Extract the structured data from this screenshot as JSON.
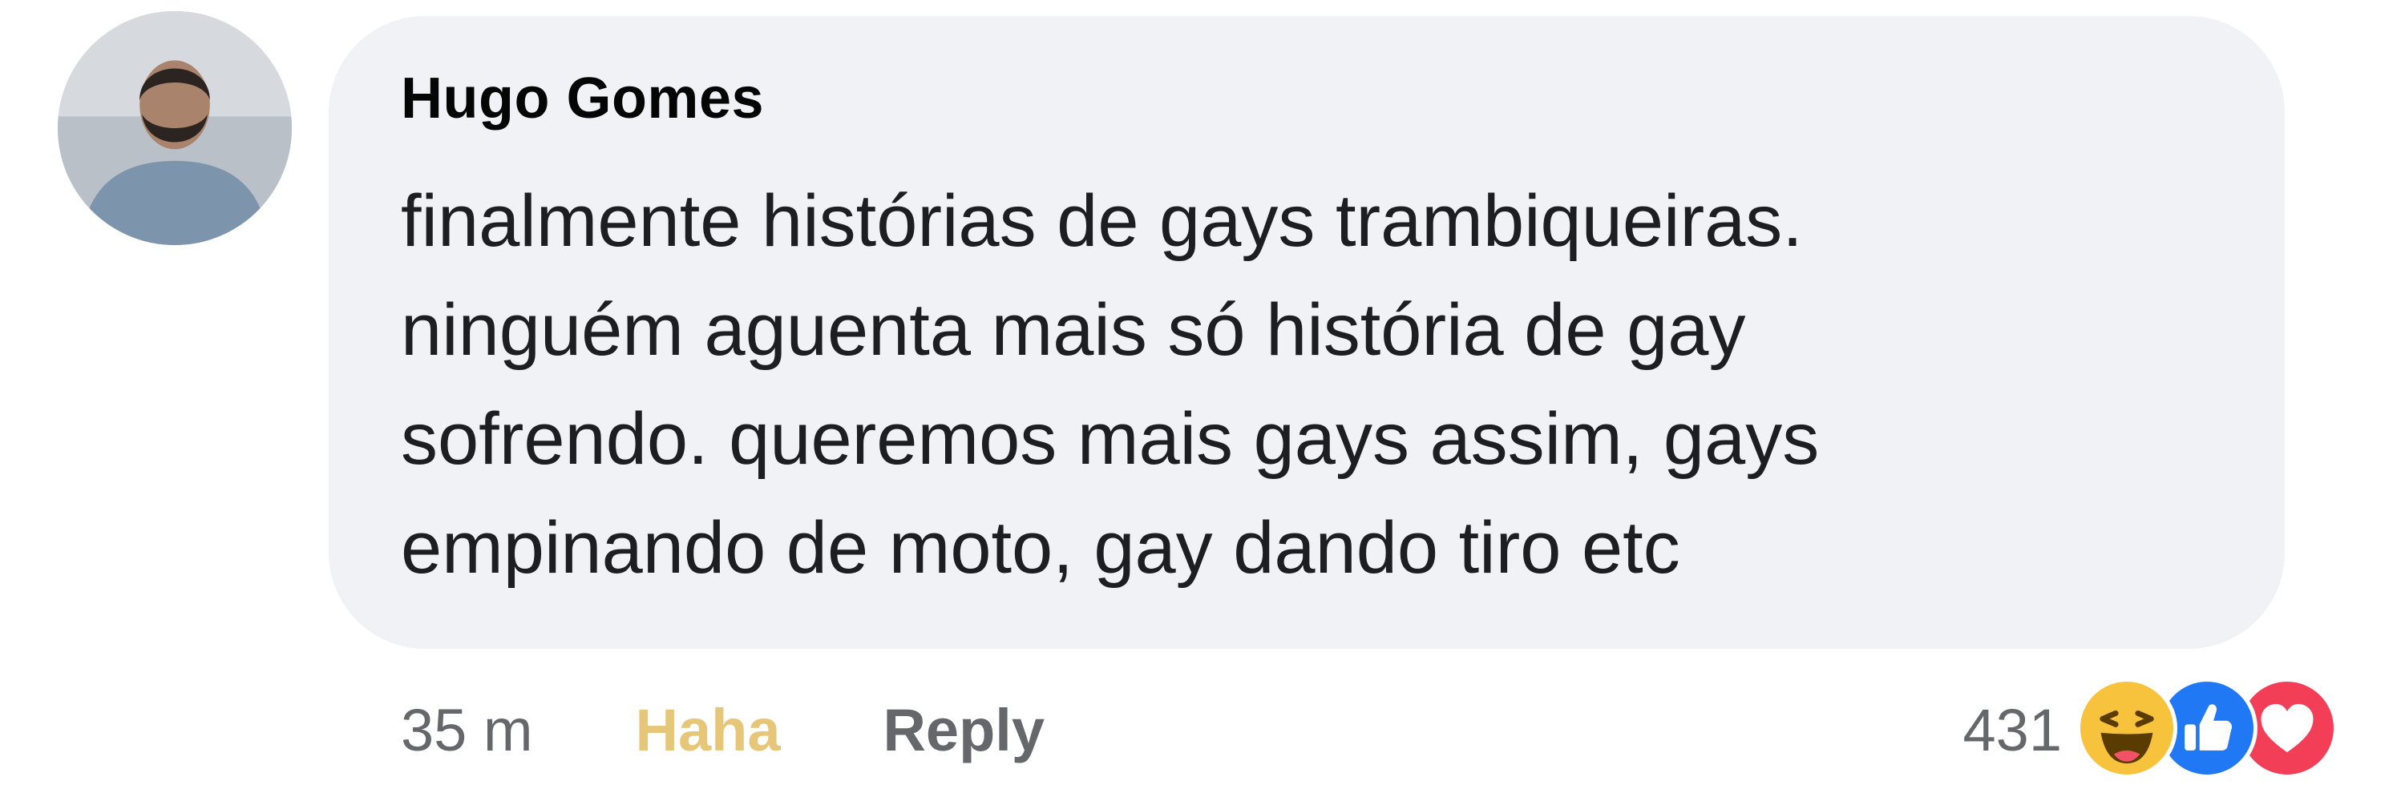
{
  "comment": {
    "author": "Hugo Gomes",
    "text_lines": [
      "finalmente histórias de gays trambiqueiras.",
      "ninguém aguenta mais só história de gay",
      "sofrendo. queremos mais gays assim, gays",
      "empinando de moto, gay dando tiro etc"
    ]
  },
  "actions": {
    "time": "35 m",
    "reaction_label": "Haha",
    "reply_label": "Reply"
  },
  "reactions": {
    "count": "431",
    "icons": [
      "haha-icon",
      "like-icon",
      "love-icon"
    ]
  },
  "colors": {
    "bubble": "#f0f2f5",
    "haha_text": "#e6c77a",
    "secondary_text": "#65676b",
    "like_blue": "#2078f4",
    "love_red": "#f33e58",
    "haha_yellow": "#f7c33d"
  }
}
